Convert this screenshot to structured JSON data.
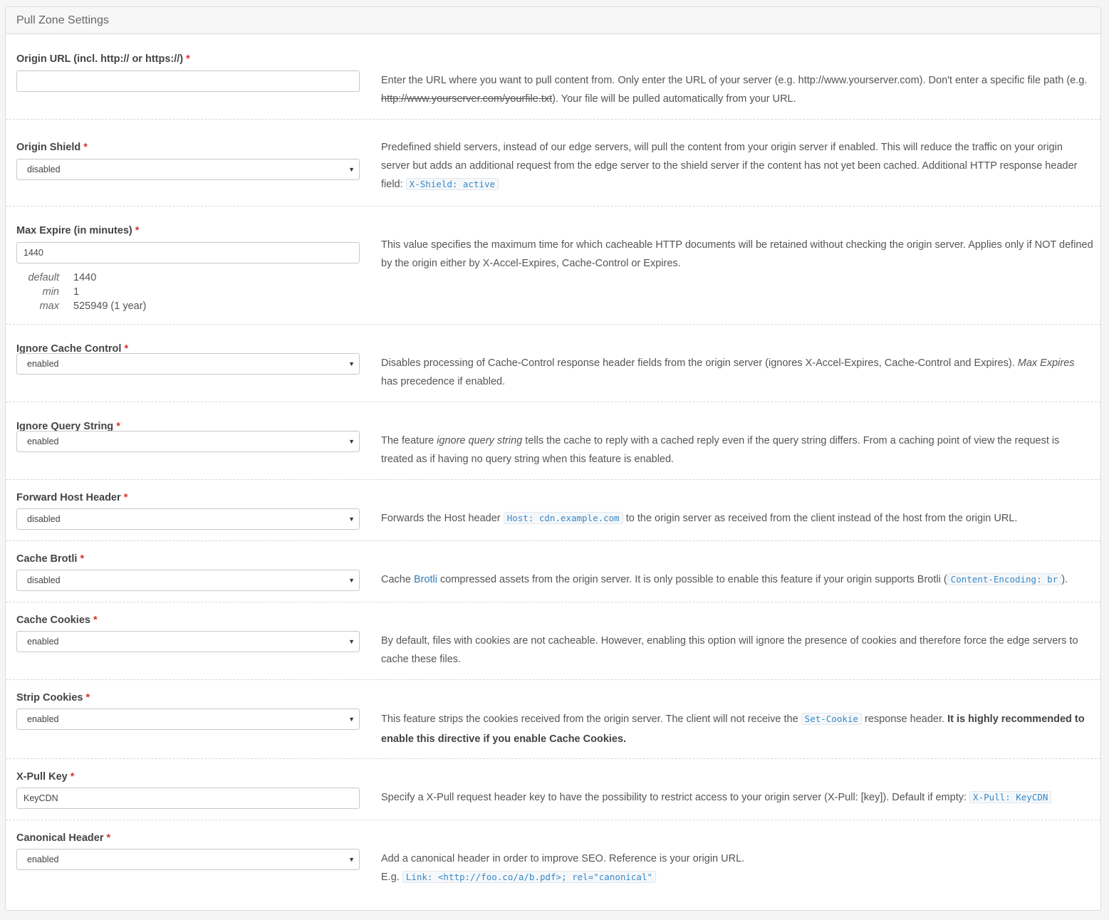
{
  "panel": {
    "title": "Pull Zone Settings"
  },
  "required_mark": "*",
  "rows": {
    "origin_url": {
      "label": "Origin URL (incl. http:// or https://)",
      "value": "",
      "help_a": "Enter the URL where you want to pull content from. Only enter the URL of your server (e.g. http://www.yourserver.com). Don't enter a specific file path (e.g. ",
      "help_strike": "http://www.yourserver.com/yourfile.txt",
      "help_b": "). Your file will be pulled automatically from your URL."
    },
    "origin_shield": {
      "label": "Origin Shield",
      "value": "disabled",
      "help_a": "Predefined shield servers, instead of our edge servers, will pull the content from your origin server if enabled. This will reduce the traffic on your origin server but adds an additional request from the edge server to the shield server if the content has not yet been cached. Additional HTTP response header field: ",
      "code": "X-Shield: active"
    },
    "max_expire": {
      "label": "Max Expire (in minutes)",
      "value": "1440",
      "limits": [
        {
          "key": "default",
          "value": "1440"
        },
        {
          "key": "min",
          "value": "1"
        },
        {
          "key": "max",
          "value": "525949 (1 year)"
        }
      ],
      "help": "This value specifies the maximum time for which cacheable HTTP documents will be retained without checking the origin server. Applies only if NOT defined by the origin either by X-Accel-Expires, Cache-Control or Expires."
    },
    "ignore_cache_control": {
      "label": "Ignore Cache Control",
      "value": "enabled",
      "help_a": "Disables processing of Cache-Control response header fields from the origin server (ignores X-Accel-Expires, Cache-Control and Expires). ",
      "help_em": "Max Expires",
      "help_b": " has precedence if enabled."
    },
    "ignore_query_string": {
      "label": "Ignore Query String",
      "value": "enabled",
      "help_a": "The feature ",
      "help_em": "ignore query string",
      "help_b": " tells the cache to reply with a cached reply even if the query string differs. From a caching point of view the request is treated as if having no query string when this feature is enabled."
    },
    "forward_host_header": {
      "label": "Forward Host Header",
      "value": "disabled",
      "help_a": "Forwards the Host header ",
      "code": "Host: cdn.example.com",
      "help_b": " to the origin server as received from the client instead of the host from the origin URL."
    },
    "cache_brotli": {
      "label": "Cache Brotli",
      "value": "disabled",
      "help_a": "Cache ",
      "link": "Brotli",
      "help_b": " compressed assets from the origin server. It is only possible to enable this feature if your origin supports Brotli (",
      "code": "Content-Encoding: br",
      "help_c": ")."
    },
    "cache_cookies": {
      "label": "Cache Cookies",
      "value": "enabled",
      "help": "By default, files with cookies are not cacheable. However, enabling this option will ignore the presence of cookies and therefore force the edge servers to cache these files."
    },
    "strip_cookies": {
      "label": "Strip Cookies",
      "value": "enabled",
      "help_a": "This feature strips the cookies received from the origin server. The client will not receive the ",
      "code": "Set-Cookie",
      "help_b": " response header. ",
      "help_strong": "It is highly recommended to enable this directive if you enable Cache Cookies."
    },
    "x_pull_key": {
      "label": "X-Pull Key",
      "value": "KeyCDN",
      "help_a": "Specify a X-Pull request header key to have the possibility to restrict access to your origin server (X-Pull: [key]). Default if empty: ",
      "code": "X-Pull: KeyCDN"
    },
    "canonical_header": {
      "label": "Canonical Header",
      "value": "enabled",
      "help_a": "Add a canonical header in order to improve SEO. Reference is your origin URL.",
      "help_eg": "E.g. ",
      "code": "Link: <http://foo.co/a/b.pdf>; rel=\"canonical\""
    }
  }
}
